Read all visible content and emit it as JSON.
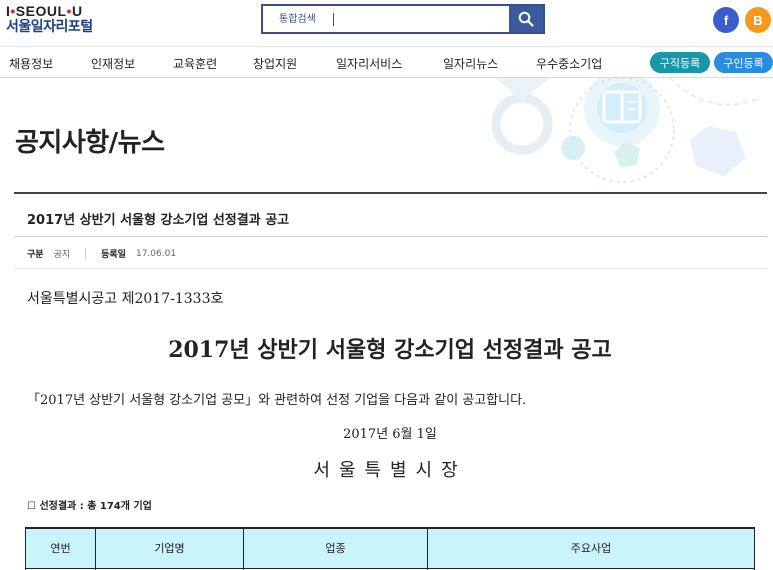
{
  "header": {
    "logo_top_1": "I",
    "logo_top_2": "SEOUL",
    "logo_top_3": "U",
    "logo_bottom": "서울일자리포털",
    "search_placeholder": "통합검색",
    "facebook_label": "f",
    "blog_label": "B"
  },
  "nav": {
    "items": [
      "채용정보",
      "인재정보",
      "교육훈련",
      "창업지원",
      "일자리서비스",
      "일자리뉴스",
      "우수중소기업"
    ],
    "job_seek_button": "구직등록",
    "job_post_button": "구인등록"
  },
  "page": {
    "title": "공지사항/뉴스"
  },
  "article": {
    "title": "2017년 상반기 서울형 강소기업 선정결과 공고",
    "category_label": "구분",
    "category_value": "공지",
    "date_label": "등록일",
    "date_value": "17.06.01"
  },
  "body": {
    "notice_number": "서울특별시공고 제2017-1333호",
    "doc_title": "2017년 상반기 서울형 강소기업 선정결과 공고",
    "intro": "「2017년 상반기 서울형 강소기업 공모」와 관련하여 선정 기업을 다음과 같이 공고합니다.",
    "date": "2017년 6월 1일",
    "org": "서울특별시장",
    "result_line": "☐ 선정결과 : 총 174개 기업"
  },
  "table": {
    "headers": [
      "연번",
      "기업명",
      "업종",
      "주요사업"
    ]
  },
  "colors": {
    "brand_navy": "#1d3f7f",
    "search_border": "#3a4e8c",
    "job_seek": "#1797a8",
    "job_post": "#2a8ce0",
    "table_header_bg": "#c9f4fb",
    "facebook": "#3b5ccb",
    "blog": "#f39a1d"
  }
}
